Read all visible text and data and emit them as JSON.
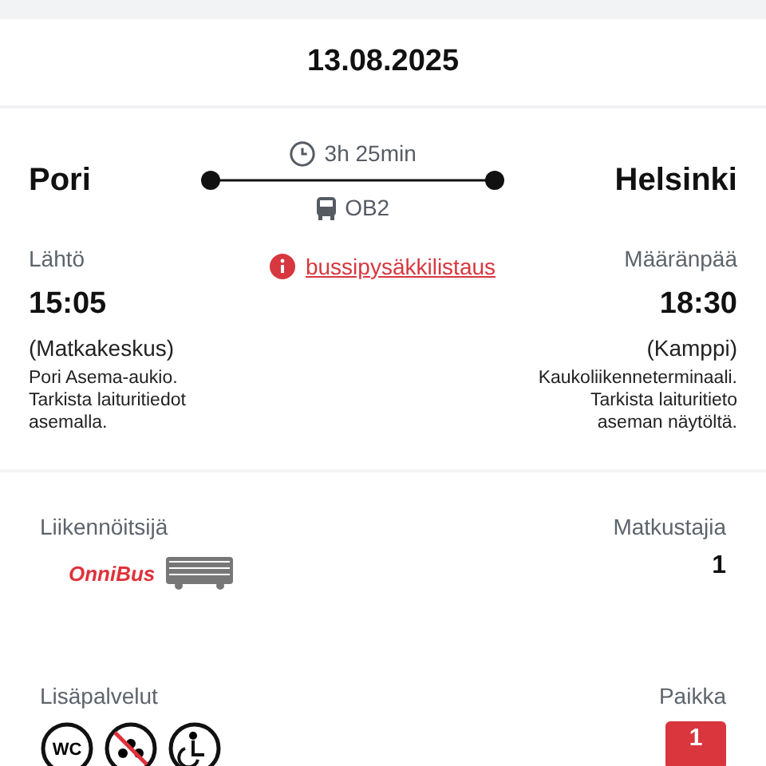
{
  "date": "13.08.2025",
  "route": {
    "origin": "Pori",
    "destination": "Helsinki",
    "duration": "3h 25min",
    "line": "OB2"
  },
  "info_link": "bussipysäkkilistaus",
  "departure": {
    "label": "Lähtö",
    "time": "15:05",
    "station": "(Matkakeskus)",
    "note": "Pori Asema-aukio. Tarkista laituritiedot asemalla."
  },
  "arrival": {
    "label": "Määränpää",
    "time": "18:30",
    "station": "(Kamppi)",
    "note": "Kaukoliikenneterminaali. Tarkista laituritieto aseman näytöltä."
  },
  "operator": {
    "label": "Liikennöitsijä",
    "logo_text": "OnniBus"
  },
  "passengers": {
    "label": "Matkustajia",
    "value": "1"
  },
  "services": {
    "label": "Lisäpalvelut",
    "items": [
      {
        "kind": "wc",
        "text": "WC"
      },
      {
        "kind": "no_pets"
      },
      {
        "kind": "wheelchair"
      }
    ]
  },
  "seat": {
    "label": "Paikka",
    "value": "1"
  }
}
